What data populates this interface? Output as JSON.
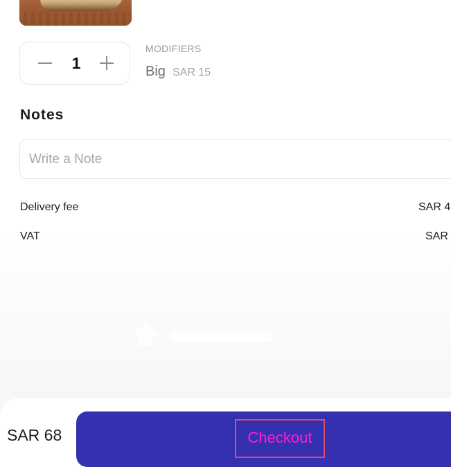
{
  "product": {
    "image_icon": "shawarma-image"
  },
  "quantity": {
    "value": "1",
    "minus_icon": "minus-icon",
    "plus_icon": "plus-icon"
  },
  "modifiers": {
    "label": "MODIFIERS",
    "items": [
      {
        "name": "Big",
        "price": "SAR 15"
      }
    ]
  },
  "notes": {
    "title": "Notes",
    "placeholder": "Write a Note",
    "value": ""
  },
  "fees": [
    {
      "label": "Delivery fee",
      "value": "SAR 4"
    },
    {
      "label": "VAT",
      "value": "SAR"
    }
  ],
  "footer": {
    "total": "SAR 68",
    "checkout_label": "Checkout"
  },
  "colors": {
    "accent": "#3430b0",
    "checkout_text": "#ff1fd0",
    "highlight_border": "#e04a6a"
  }
}
